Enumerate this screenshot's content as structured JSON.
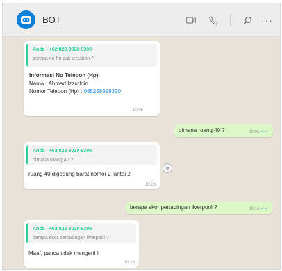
{
  "header": {
    "title": "BOT",
    "avatar_icon": "robot-icon",
    "icons": [
      "video-call-icon",
      "phone-icon",
      "search-icon",
      "more-icon"
    ],
    "more_label": "···"
  },
  "messages": {
    "m1": {
      "quote_author": "Anda - +62 822-3028-9399",
      "quote_text": "berapa no hp pak izzuddin ?",
      "line1": "Informasi No Telepon (Hp):",
      "line2": "Nama : Ahmad Izzuddin",
      "line3_prefix": "Nomor Telepon (Hp) : ",
      "line3_link": "085258999320",
      "time": "10.05"
    },
    "m2": {
      "text": "dimana ruang 40 ?",
      "time": "10.06",
      "tick": "✓✓"
    },
    "m3": {
      "quote_author": "Anda - +62 822-3028-9399",
      "quote_text": "dimana ruang 40 ?",
      "text": "ruang 40 digedung barat nomor 2 lantai 2",
      "time": "10.06"
    },
    "m4": {
      "text": "berapa skor pertadingan liverpool ?",
      "time": "10.16",
      "tick": "✓✓"
    },
    "m5": {
      "quote_author": "Anda - +62 822-3028-9399",
      "quote_text": "berapa skor pertadingan liverpool ?",
      "text": "Maaf, panca tidak mengerti !",
      "time": "10.16"
    }
  },
  "colors": {
    "chat_background": "#e9e2d9",
    "outgoing_bubble": "#dcf8c6",
    "quote_accent": "#35cd96",
    "link": "#2c84cc",
    "avatar": "#0e7fd6"
  }
}
